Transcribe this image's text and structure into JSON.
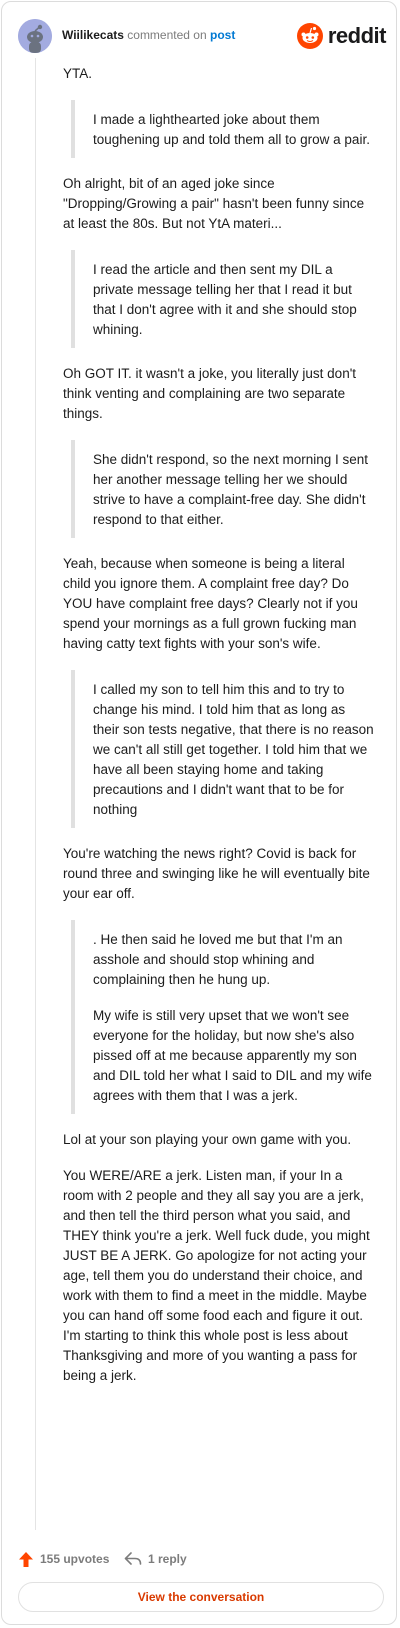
{
  "header": {
    "username": "Wiilikecats",
    "action": "commented on",
    "post_link": "post",
    "brand": "reddit"
  },
  "comment": {
    "blocks": [
      {
        "type": "p",
        "text": "YTA."
      },
      {
        "type": "quote",
        "paras": [
          "I made a lighthearted joke about them toughening up and told them all to grow a pair."
        ]
      },
      {
        "type": "p",
        "text": "Oh alright, bit of an aged joke since \"Dropping/Growing a pair\" hasn't been funny since at least the 80s. But not YtA materi..."
      },
      {
        "type": "quote",
        "paras": [
          "I read the article and then sent my DIL a private message telling her that I read it but that I don't agree with it and she should stop whining."
        ]
      },
      {
        "type": "p",
        "text": "Oh GOT IT. it wasn't a joke, you literally just don't think venting and complaining are two separate things."
      },
      {
        "type": "quote",
        "paras": [
          "She didn't respond, so the next morning I sent her another message telling her we should strive to have a complaint-free day. She didn't respond to that either."
        ]
      },
      {
        "type": "p",
        "text": "Yeah, because when someone is being a literal child you ignore them. A complaint free day? Do YOU have complaint free days? Clearly not if you spend your mornings as a full grown fucking man having catty text fights with your son's wife."
      },
      {
        "type": "quote",
        "paras": [
          "I called my son to tell him this and to try to change his mind. I told him that as long as their son tests negative, that there is no reason we can't all still get together. I told him that we have all been staying home and taking precautions and I didn't want that to be for nothing"
        ]
      },
      {
        "type": "p",
        "text": "You're watching the news right? Covid is back for round three and swinging like he will eventually bite your ear off."
      },
      {
        "type": "quote",
        "paras": [
          ". He then said he loved me but that I'm an asshole and should stop whining and complaining then he hung up.",
          "My wife is still very upset that we won't see everyone for the holiday, but now she's also pissed off at me because apparently my son and DIL told her what I said to DIL and my wife agrees with them that I was a jerk."
        ]
      },
      {
        "type": "p",
        "text": "Lol at your son playing your own game with you."
      },
      {
        "type": "p",
        "text": "You WERE/ARE a jerk. Listen man, if your In a room with 2 people and they all say you are a jerk, and then tell the third person what you said, and THEY think you're a jerk. Well fuck dude, you might JUST BE A JERK. Go apologize for not acting your age, tell them you do understand their choice, and work with them to find a meet in the middle. Maybe you can hand off some food each and figure it out. I'm starting to think this whole post is less about Thanksgiving and more of you wanting a pass for being a jerk."
      }
    ]
  },
  "footer": {
    "upvotes": "155 upvotes",
    "replies": "1 reply",
    "upvote_icon": "upvote-arrow-icon",
    "reply_icon": "reply-arrow-icon"
  },
  "cta": {
    "label": "View the conversation"
  },
  "colors": {
    "brand_orange": "#ff4500",
    "link_blue": "#0079d3",
    "cta_text": "#d93a00",
    "avatar": "#a3abe0"
  }
}
